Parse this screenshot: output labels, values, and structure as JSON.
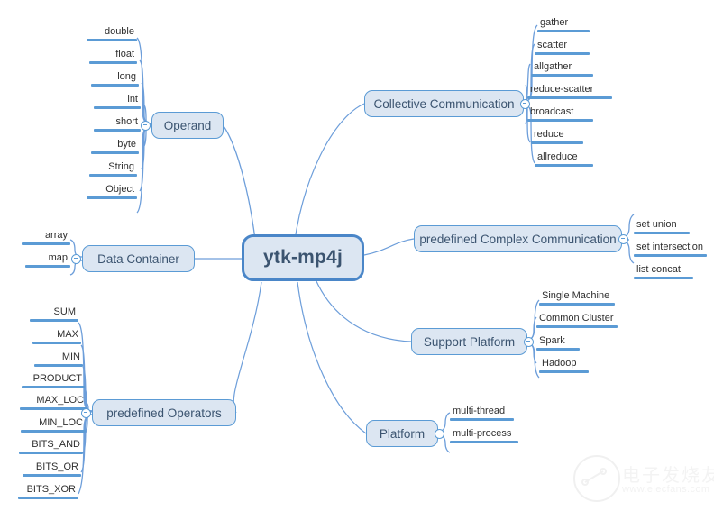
{
  "diagram": {
    "type": "mind-map",
    "root": {
      "label": "ytk-mp4j"
    },
    "branches": [
      {
        "id": "operand",
        "label": "Operand",
        "side": "left",
        "children": [
          "double",
          "float",
          "long",
          "int",
          "short",
          "byte",
          "String",
          "Object"
        ]
      },
      {
        "id": "data-container",
        "label": "Data Container",
        "side": "left",
        "children": [
          "array",
          "map"
        ]
      },
      {
        "id": "predefined-operators",
        "label": "predefined Operators",
        "side": "left",
        "children": [
          "SUM",
          "MAX",
          "MIN",
          "PRODUCT",
          "MAX_LOC",
          "MIN_LOC",
          "BITS_AND",
          "BITS_OR",
          "BITS_XOR"
        ]
      },
      {
        "id": "collective-communication",
        "label": "Collective Communication",
        "side": "right",
        "children": [
          "gather",
          "scatter",
          "allgather",
          "reduce-scatter",
          "broadcast",
          "reduce",
          "allreduce"
        ]
      },
      {
        "id": "predefined-complex-communication",
        "label": "predefined Complex Communication",
        "side": "right",
        "children": [
          "set union",
          "set intersection",
          "list concat"
        ]
      },
      {
        "id": "support-platform",
        "label": "Support Platform",
        "side": "right",
        "children": [
          "Single Machine",
          "Common Cluster",
          "Spark",
          "Hadoop"
        ]
      },
      {
        "id": "platform",
        "label": "Platform",
        "side": "right",
        "children": [
          "multi-thread",
          "multi-process"
        ]
      }
    ]
  },
  "watermark": {
    "cn_text": "电子发烧友",
    "url_text": "www.elecfans.com"
  },
  "colors": {
    "node_fill": "#dce6f2",
    "node_border": "#5b9bd5",
    "root_border": "#4a86c8",
    "wire": "#6d9eda",
    "leaf_bar": "#5b9bd5",
    "text": "#3b5470",
    "background": "#ffffff"
  }
}
